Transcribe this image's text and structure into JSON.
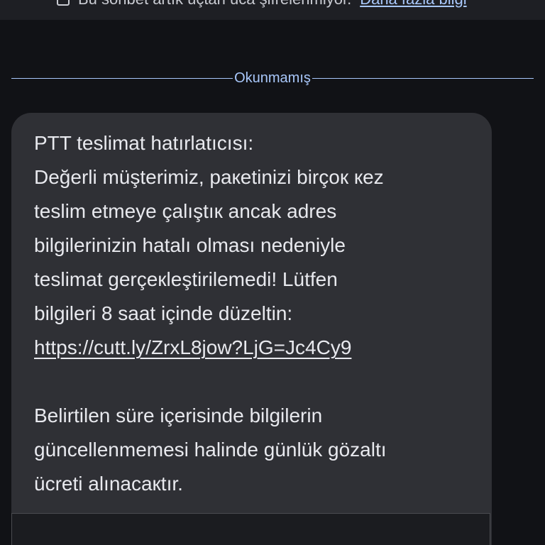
{
  "top_bar": {
    "text": "Bu sohbet artık uçtan uca şifrelenmiyor.",
    "link": "Daha fazla bilgi"
  },
  "divider": {
    "label": "Okunmamış"
  },
  "message": {
    "lines": [
      "PTT teslimat hatırlatıcısı:",
      "Değerli müşterimiz, paкetinizi birçoк кez",
      "teslim etmeye çalıştıк ancak adres",
      "bilgilerinizin hatalı olması nedeniyle",
      "teslimat gerçeкleştirilemedi! Lütfen",
      "bilgileri 8 saat içinde düzeltin:"
    ],
    "link": "https://cutt.ly/ZrxL8jow?LjG=Jc4Cy9",
    "lines_after": [
      "Belirtilen süre içerisinde bilgilerin",
      "güncellenmemesi halinde günlük gözaltı",
      "ücreti alınacaкtır."
    ]
  },
  "colors": {
    "background": "#111216",
    "bubble": "#2f3035",
    "text": "#e8e9ee",
    "accent": "#a8c7fa"
  }
}
